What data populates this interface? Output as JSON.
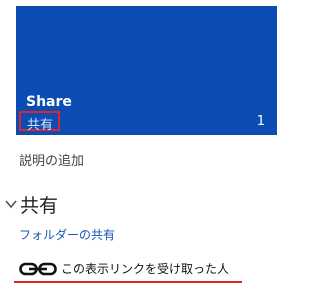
{
  "tile": {
    "title": "Share",
    "subtitle": "共有",
    "count": "1",
    "background_color": "#0b4db3",
    "highlight_color": "#e0242f"
  },
  "description": {
    "add_label": "説明の追加"
  },
  "sharing_section": {
    "title": "共有",
    "expanded_icon": "chevron-down-icon",
    "folder_share_link": "フォルダーの共有",
    "entry": {
      "icon": "link-icon",
      "label": "この表示リンクを受け取った人"
    }
  }
}
